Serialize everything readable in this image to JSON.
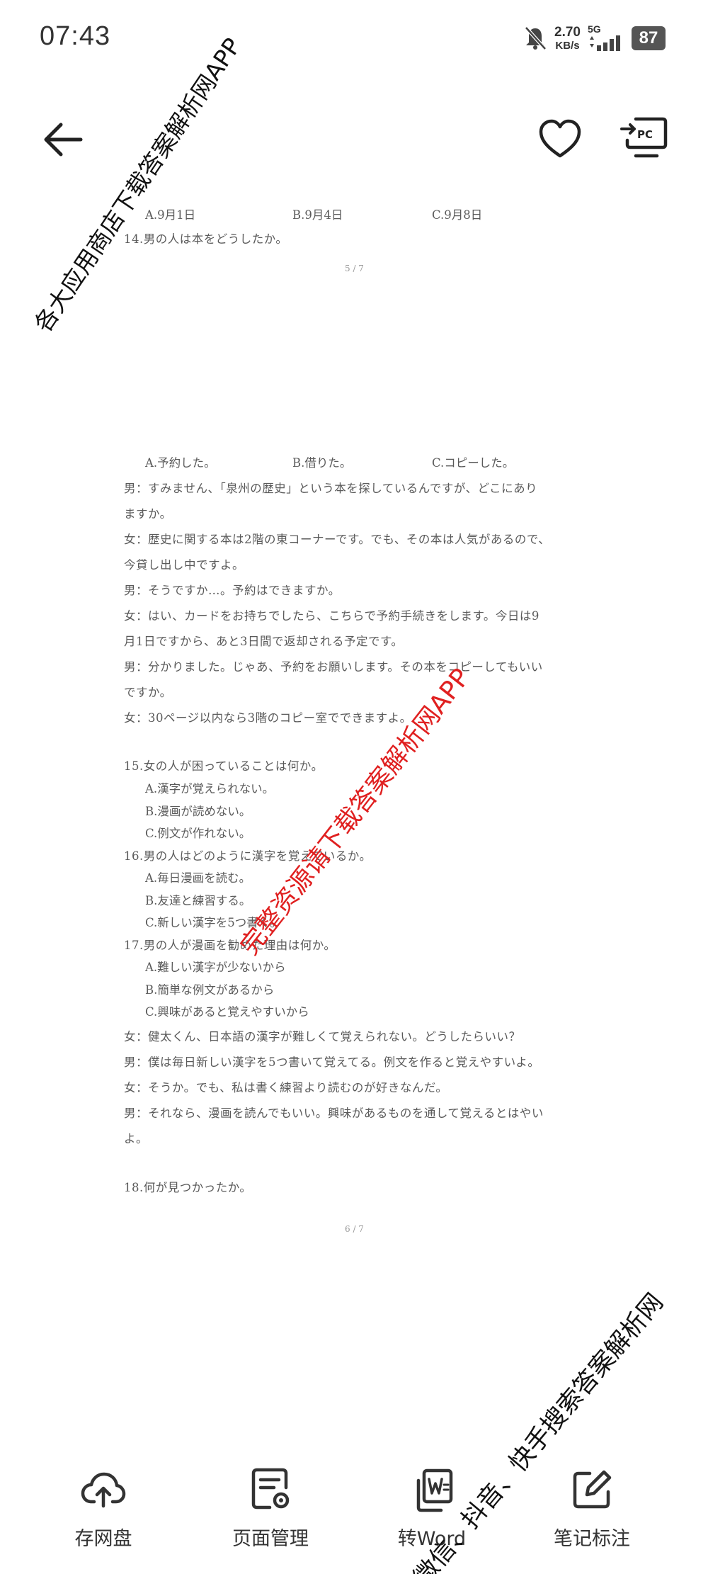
{
  "status_bar": {
    "time": "07:43",
    "net_speed_value": "2.70",
    "net_speed_unit": "KB/s",
    "signal_label": "5G",
    "battery": "87"
  },
  "top_bar": {
    "back_icon": "arrow-left-icon",
    "favorite_icon": "heart-icon",
    "pc_icon": "cast-to-pc-icon",
    "pc_label": "PC"
  },
  "document": {
    "q13_options": [
      "A.9月1日",
      "B.9月4日",
      "C.9月8日"
    ],
    "q14": "14.男の人は本をどうしたか。",
    "page5": "5 / 7",
    "q14_options": [
      "A.予約した。",
      "B.借りた。",
      "C.コピーした。"
    ],
    "dialogue1": [
      "男：すみません、「泉州の歴史」という本を探しているんですが、どこにあり",
      "ますか。",
      "女：歴史に関する本は2階の東コーナーです。でも、その本は人気があるので、",
      "今貸し出し中ですよ。",
      "男：そうですか…。予約はできますか。",
      "女：はい、カードをお持ちでしたら、こちらで予約手続きをします。今日は9",
      "月1日ですから、あと3日間で返却される予定です。",
      "男：分かりました。じゃあ、予約をお願いします。その本をコピーしてもいい",
      "ですか。",
      "女：30ページ以内なら3階のコピー室でできますよ。"
    ],
    "q15": "15.女の人が困っていることは何か。",
    "q15_options": [
      "A.漢字が覚えられない。",
      "B.漫画が読めない。",
      "C.例文が作れない。"
    ],
    "q16": "16.男の人はどのように漢字を覚えているか。",
    "q16_options": [
      "A.毎日漫画を読む。",
      "B.友達と練習する。",
      "C.新しい漢字を5つ書く。"
    ],
    "q17": "17.男の人が漫画を勧めた理由は何か。",
    "q17_options": [
      "A.難しい漢字が少ないから",
      "B.簡単な例文があるから",
      "C.興味があると覚えやすいから"
    ],
    "dialogue2": [
      "女：健太くん、日本語の漢字が難しくて覚えられない。どうしたらいい？",
      "男：僕は毎日新しい漢字を5つ書いて覚えてる。例文を作ると覚えやすいよ。",
      "女：そうか。でも、私は書く練習より読むのが好きなんだ。",
      "男：それなら、漫画を読んでもいい。興味があるものを通して覚えるとはやい",
      "よ。"
    ],
    "q18": "18.何が見つかったか。",
    "page6": "6 / 7"
  },
  "watermarks": {
    "top_left": "各大应用商店下载答案解析网APP",
    "center": "完整资源请下载答案解析网APP",
    "bottom_right": "微信、抖音、快手搜索答案解析网"
  },
  "toolbar": {
    "items": [
      {
        "label": "存网盘",
        "icon": "cloud-upload-icon"
      },
      {
        "label": "页面管理",
        "icon": "page-settings-icon"
      },
      {
        "label": "转Word",
        "icon": "word-convert-icon"
      },
      {
        "label": "笔记标注",
        "icon": "edit-note-icon"
      }
    ]
  }
}
